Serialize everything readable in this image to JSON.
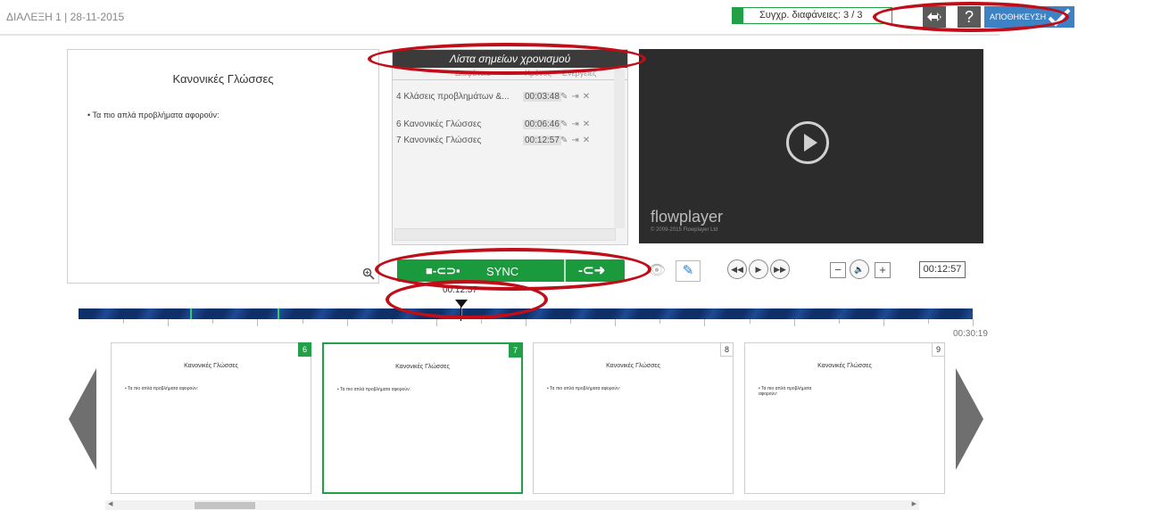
{
  "header": {
    "lecture_title": "ΔΙΑΛΕΞΗ 1 | 28-11-2015",
    "sync_count_label": "Συγχρ. διαφάνειες: 3 / 3",
    "help_label": "?",
    "save_label": "ΑΠΟΘΗΚΕΥΣΗ"
  },
  "slide_preview": {
    "title": "Κανονικές Γλώσσες",
    "bullet": "•  Τα πιο απλά προβλήματα αφορούν:"
  },
  "sync_list": {
    "title": "Λίστα σημείων χρονισμού",
    "col_slide": "Διαφάνεια",
    "col_time": "Χρόνος",
    "col_actions": "Ενέργειες",
    "rows": [
      {
        "label": "4 Κλάσεις προβλημάτων &...",
        "time": "00:03:48"
      },
      {
        "label": "6 Κανονικές Γλώσσες",
        "time": "00:06:46"
      },
      {
        "label": "7 Κανονικές Γλώσσες",
        "time": "00:12:57"
      }
    ]
  },
  "video": {
    "brand": "flowplayer",
    "copyright": "© 2009-2015 Flowplayer Ltd"
  },
  "controls": {
    "sync_label": "SYNC",
    "current_time": "00:12:57"
  },
  "timeline": {
    "cursor_time": "00:12:57",
    "end_time": "00:30:19",
    "cursor_fraction": 0.427,
    "marker_fractions": [
      0.125,
      0.223,
      0.427
    ]
  },
  "thumbnails": [
    {
      "number": "6",
      "title": "Κανονικές Γλώσσες",
      "bullet": "•  Τα πιο απλά προβλήματα αφορούν:",
      "synced": true,
      "active": false
    },
    {
      "number": "7",
      "title": "Κανονικές Γλώσσες",
      "bullet": "•  Τα πιο απλά προβλήματα αφορούν:",
      "synced": true,
      "active": true
    },
    {
      "number": "8",
      "title": "Κανονικές Γλώσσες",
      "bullet": "•  Τα πιο απλά προβλήματα αφορούν:",
      "synced": false,
      "active": false
    },
    {
      "number": "9",
      "title": "Κανονικές Γλώσσες",
      "bullet": "•  Τα πιο απλά προβλήματα αφορούν:",
      "synced": false,
      "active": false
    }
  ],
  "icons": {
    "zoom": "zoom-in-icon",
    "jump": "jump-to-slide-icon",
    "preview": "eye-icon",
    "edit": "edit-icon",
    "rewind": "rewind-icon",
    "play": "play-icon",
    "forward": "fast-forward-icon",
    "volume_down": "minus-icon",
    "volume": "volume-icon",
    "volume_up": "plus-icon"
  },
  "colors": {
    "accent_green": "#22a047",
    "save_blue": "#3c82c4",
    "annotation_red": "#c00d17",
    "timeline_blue": "#0f2f68"
  }
}
